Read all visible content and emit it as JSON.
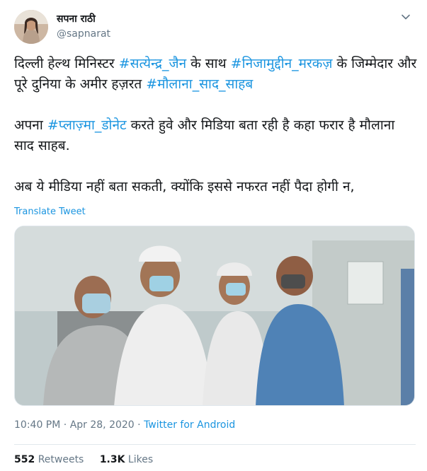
{
  "account": {
    "display_name": "सपना राठी",
    "handle": "@sapnarat"
  },
  "tweet": {
    "paragraphs": [
      {
        "segments": [
          {
            "text": "दिल्ली हेल्थ मिनिस्टर ",
            "tag": false
          },
          {
            "text": "#सत्येन्द्र_जैन",
            "tag": true
          },
          {
            "text": " के साथ ",
            "tag": false
          },
          {
            "text": "#निजामुद्दीन_मरकज़",
            "tag": true
          },
          {
            "text": " के जिम्मेदार और पूरे दुनिया के अमीर हज़रत ",
            "tag": false
          },
          {
            "text": "#मौलाना_साद_साहब",
            "tag": true
          }
        ]
      },
      {
        "segments": [
          {
            "text": "अपना ",
            "tag": false
          },
          {
            "text": "#प्लाज़्मा_डोनेट",
            "tag": true
          },
          {
            "text": " करते हुवे और मिडिया बता रही है कहा फरार है मौलाना साद साहब.",
            "tag": false
          }
        ]
      },
      {
        "segments": [
          {
            "text": "अब ये मीडिया नहीं बता सकती, क्योंकि इससे नफरत नहीं पैदा होगी न,",
            "tag": false
          }
        ]
      }
    ],
    "translate_label": "Translate Tweet",
    "time": "10:40 PM",
    "date": "Apr 28, 2020",
    "separator": " · ",
    "source": "Twitter for Android"
  },
  "stats": {
    "retweets_count": "552",
    "retweets_label": "Retweets",
    "likes_count": "1.3K",
    "likes_label": "Likes"
  },
  "icons": {
    "chevron": "chevron-down-icon"
  },
  "colors": {
    "link": "#1b95e0",
    "text": "#14171a",
    "muted": "#657786"
  }
}
